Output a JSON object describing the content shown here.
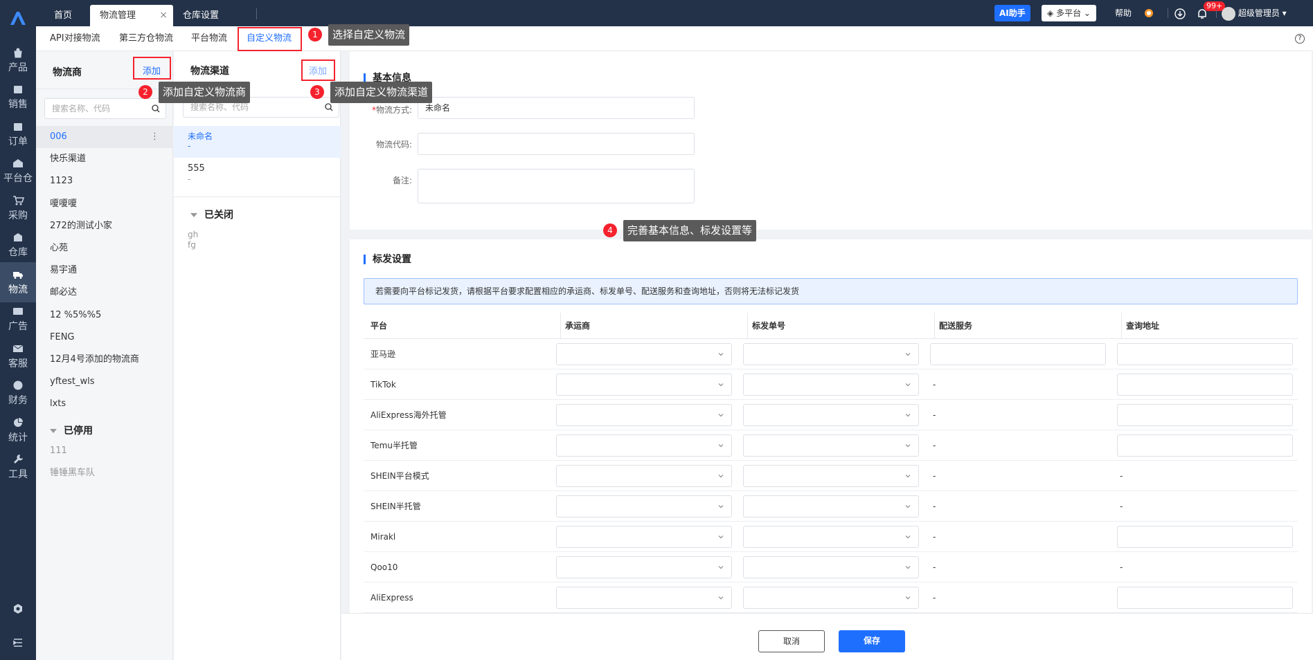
{
  "nav": {
    "items": [
      {
        "label": "产品",
        "icon": "bag-icon"
      },
      {
        "label": "销售",
        "icon": "sell-icon"
      },
      {
        "label": "订单",
        "icon": "order-icon"
      },
      {
        "label": "平台仓",
        "icon": "warehouse-icon"
      },
      {
        "label": "采购",
        "icon": "cart-icon"
      },
      {
        "label": "仓库",
        "icon": "store-icon"
      },
      {
        "label": "物流",
        "icon": "truck-icon"
      },
      {
        "label": "广告",
        "icon": "ad-icon"
      },
      {
        "label": "客服",
        "icon": "mail-icon"
      },
      {
        "label": "财务",
        "icon": "money-icon"
      },
      {
        "label": "统计",
        "icon": "pie-icon"
      },
      {
        "label": "工具",
        "icon": "wrench-icon"
      }
    ]
  },
  "tabs": [
    {
      "label": "首页"
    },
    {
      "label": "物流管理"
    },
    {
      "label": "仓库设置"
    }
  ],
  "header": {
    "ai": "AI助手",
    "platform": "多平台",
    "help": "帮助",
    "badge": "99+",
    "user": "超级管理员"
  },
  "subtabs": [
    {
      "label": "API对接物流"
    },
    {
      "label": "第三方仓物流"
    },
    {
      "label": "平台物流"
    },
    {
      "label": "自定义物流"
    }
  ],
  "carriers": {
    "title": "物流商",
    "add": "添加",
    "search": "搜索名称、代码",
    "items": [
      "006",
      "快乐渠道",
      "1123",
      "嗄嗄嗄",
      "272的测试小家",
      "心苑",
      "易宇通",
      "邮必达",
      "12 %5%%5",
      "FENG",
      "12月4号添加的物流商",
      "yftest_wls",
      "lxts"
    ],
    "disabled_title": "已停用",
    "disabled": [
      "111",
      "锤锤黑车队"
    ]
  },
  "channels": {
    "title": "物流渠道",
    "add": "添加",
    "search": "搜索名称、代码",
    "items": [
      {
        "name": "未命名",
        "code": "-"
      },
      {
        "name": "555",
        "code": "-"
      }
    ],
    "closed_title": "已关闭",
    "closed": [
      "gh",
      "fg"
    ]
  },
  "basic": {
    "title": "基本信息",
    "method_label": "物流方式:",
    "method_value": "未命名",
    "code_label": "物流代码:",
    "remark_label": "备注:"
  },
  "mark": {
    "title": "标发设置",
    "notice": "若需要向平台标记发货，请根据平台要求配置相应的承运商、标发单号、配送服务和查询地址，否则将无法标记发货",
    "headers": [
      "平台",
      "承运商",
      "标发单号",
      "配送服务",
      "查询地址"
    ],
    "rows": [
      {
        "platform": "亚马逊",
        "service": "",
        "query": ""
      },
      {
        "platform": "TikTok",
        "service": "-",
        "query": ""
      },
      {
        "platform": "AliExpress海外托管",
        "service": "-",
        "query": ""
      },
      {
        "platform": "Temu半托管",
        "service": "-",
        "query": ""
      },
      {
        "platform": "SHEIN平台模式",
        "service": "-",
        "query": "-"
      },
      {
        "platform": "SHEIN半托管",
        "service": "-",
        "query": "-"
      },
      {
        "platform": "Mirakl",
        "service": "-",
        "query": ""
      },
      {
        "platform": "Qoo10",
        "service": "-",
        "query": "-"
      },
      {
        "platform": "AliExpress",
        "service": "-",
        "query": ""
      }
    ]
  },
  "footer": {
    "cancel": "取消",
    "save": "保存"
  },
  "callouts": [
    {
      "num": "1",
      "text": "选择自定义物流"
    },
    {
      "num": "2",
      "text": "添加自定义物流商"
    },
    {
      "num": "3",
      "text": "添加自定义物流渠道"
    },
    {
      "num": "4",
      "text": "完善基本信息、标发设置等"
    }
  ],
  "colors": {
    "accent": "#1f6fff",
    "nav_bg": "#233248",
    "callout_red": "#f5222d"
  }
}
